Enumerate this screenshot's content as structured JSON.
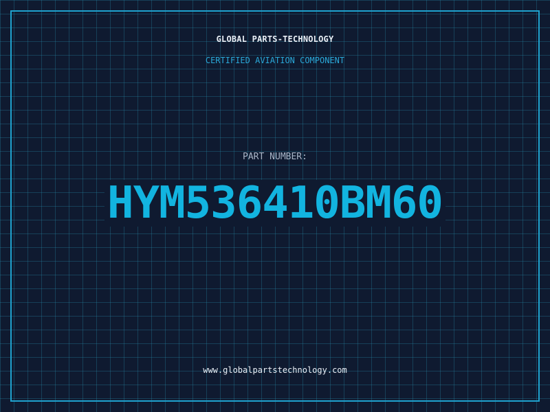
{
  "header": {
    "company_name": "GLOBAL PARTS-TECHNOLOGY",
    "tagline": "CERTIFIED AVIATION COMPONENT"
  },
  "part": {
    "label": "PART NUMBER:",
    "number": "HYM536410BM60"
  },
  "footer": {
    "website": "www.globalpartstechnology.com"
  },
  "colors": {
    "background": "#0f1a30",
    "grid": "#288caa",
    "frame": "#1fa3cf",
    "accent": "#12b4e0",
    "text": "#e8eef5",
    "muted_text": "#a9b6c8"
  }
}
